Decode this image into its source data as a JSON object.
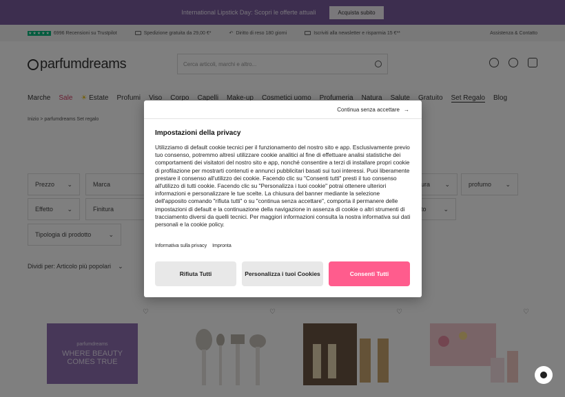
{
  "promo": {
    "text": "International Lipstick Day: Scopri le offerte attuali",
    "button": "Acquista subito"
  },
  "trust": {
    "reviews": "6996 Recensioni su Trustpilot",
    "shipping": "Spedizione gratuita da 29,00 €*",
    "returns": "Diritto di reso 180 giorni",
    "newsletter": "Iscriviti alla newsletter e risparmia 15 €**",
    "support": "Assistenza & Contatto"
  },
  "header": {
    "logo": "parfumdreams",
    "search_placeholder": "Cerca articoli, marchi e altro..."
  },
  "nav": [
    "Marche",
    "Sale",
    "Estate",
    "Profumi",
    "Viso",
    "Corpo",
    "Capelli",
    "Make-up",
    "Cosmetici uomo",
    "Profumeria",
    "Natura",
    "Salute",
    "Gratuito",
    "Set Regalo",
    "Blog"
  ],
  "breadcrumb": {
    "home": "Inizio",
    "sep": ">",
    "current": "parfumdreams Set regalo"
  },
  "filters": [
    "Prezzo",
    "Marca",
    "ura",
    "profumo",
    "Effetto",
    "Finitura",
    "to",
    "Tipologia di prodotto"
  ],
  "sort": "Dividi per: Articolo più popolari",
  "product_banner": {
    "brand": "parfumdreams",
    "tagline": "WHERE BEAUTY COMES TRUE"
  },
  "modal": {
    "skip": "Continua senza accettare",
    "title": "Impostazioni della privacy",
    "body": "Utilizziamo di default cookie tecnici per il funzionamento del nostro sito e app. Esclusivamente previo tuo consenso, potremmo altresì utilizzare cookie analitici al fine di effettuare analisi statistiche dei comportamenti dei visitatori del nostro sito e app, nonché consentire a terzi di installare propri cookie di profilazione per mostrarti contenuti e annunci pubblicitari basati sui tuoi interessi. Puoi liberamente prestare il consenso all'utilizzo dei cookie. Facendo clic su \"Consenti tutti\" presti il tuo consenso all'utilizzo di tutti cookie. Facendo clic su \"Personalizza i tuoi cookie\" potrai ottenere ulteriori informazioni e personalizzare le tue scelte. La chiusura del banner mediante la selezione dell'apposito comando \"rifiuta tutti\" o su \"continua senza accettare\", comporta il permanere delle impostazioni di default e la continuazione della navigazione in assenza di cookie o altri strumenti di tracciamento diversi da quelli tecnici. Per maggiori informazioni consulta la nostra informativa sui dati personali e la cookie policy.",
    "link_privacy": "Informativa sulla privacy",
    "link_imprint": "Impronta",
    "btn_reject": "Rifiuta Tutti",
    "btn_customize": "Personalizza i tuoi Cookies",
    "btn_accept": "Consenti Tutti"
  }
}
